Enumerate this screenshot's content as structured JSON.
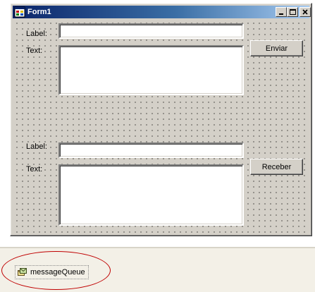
{
  "form": {
    "title": "Form1",
    "title_icon": "form-icon",
    "controls": {
      "minimize_icon": "minimize-icon",
      "maximize_icon": "maximize-icon",
      "close_icon": "close-icon"
    }
  },
  "send_group": {
    "label_caption": "Label:",
    "text_caption": "Text:",
    "label_value": "",
    "text_value": "",
    "button_label": "Enviar"
  },
  "receive_group": {
    "label_caption": "Label:",
    "text_caption": "Text:",
    "label_value": "",
    "text_value": "",
    "button_label": "Receber"
  },
  "component_tray": {
    "items": [
      {
        "label": "messageQueue",
        "icon": "message-queue-icon"
      }
    ],
    "highlight_color": "#c00000"
  },
  "colors": {
    "titlebar_start": "#0a246a",
    "titlebar_end": "#a6caf0",
    "face": "#d4d0c8"
  }
}
